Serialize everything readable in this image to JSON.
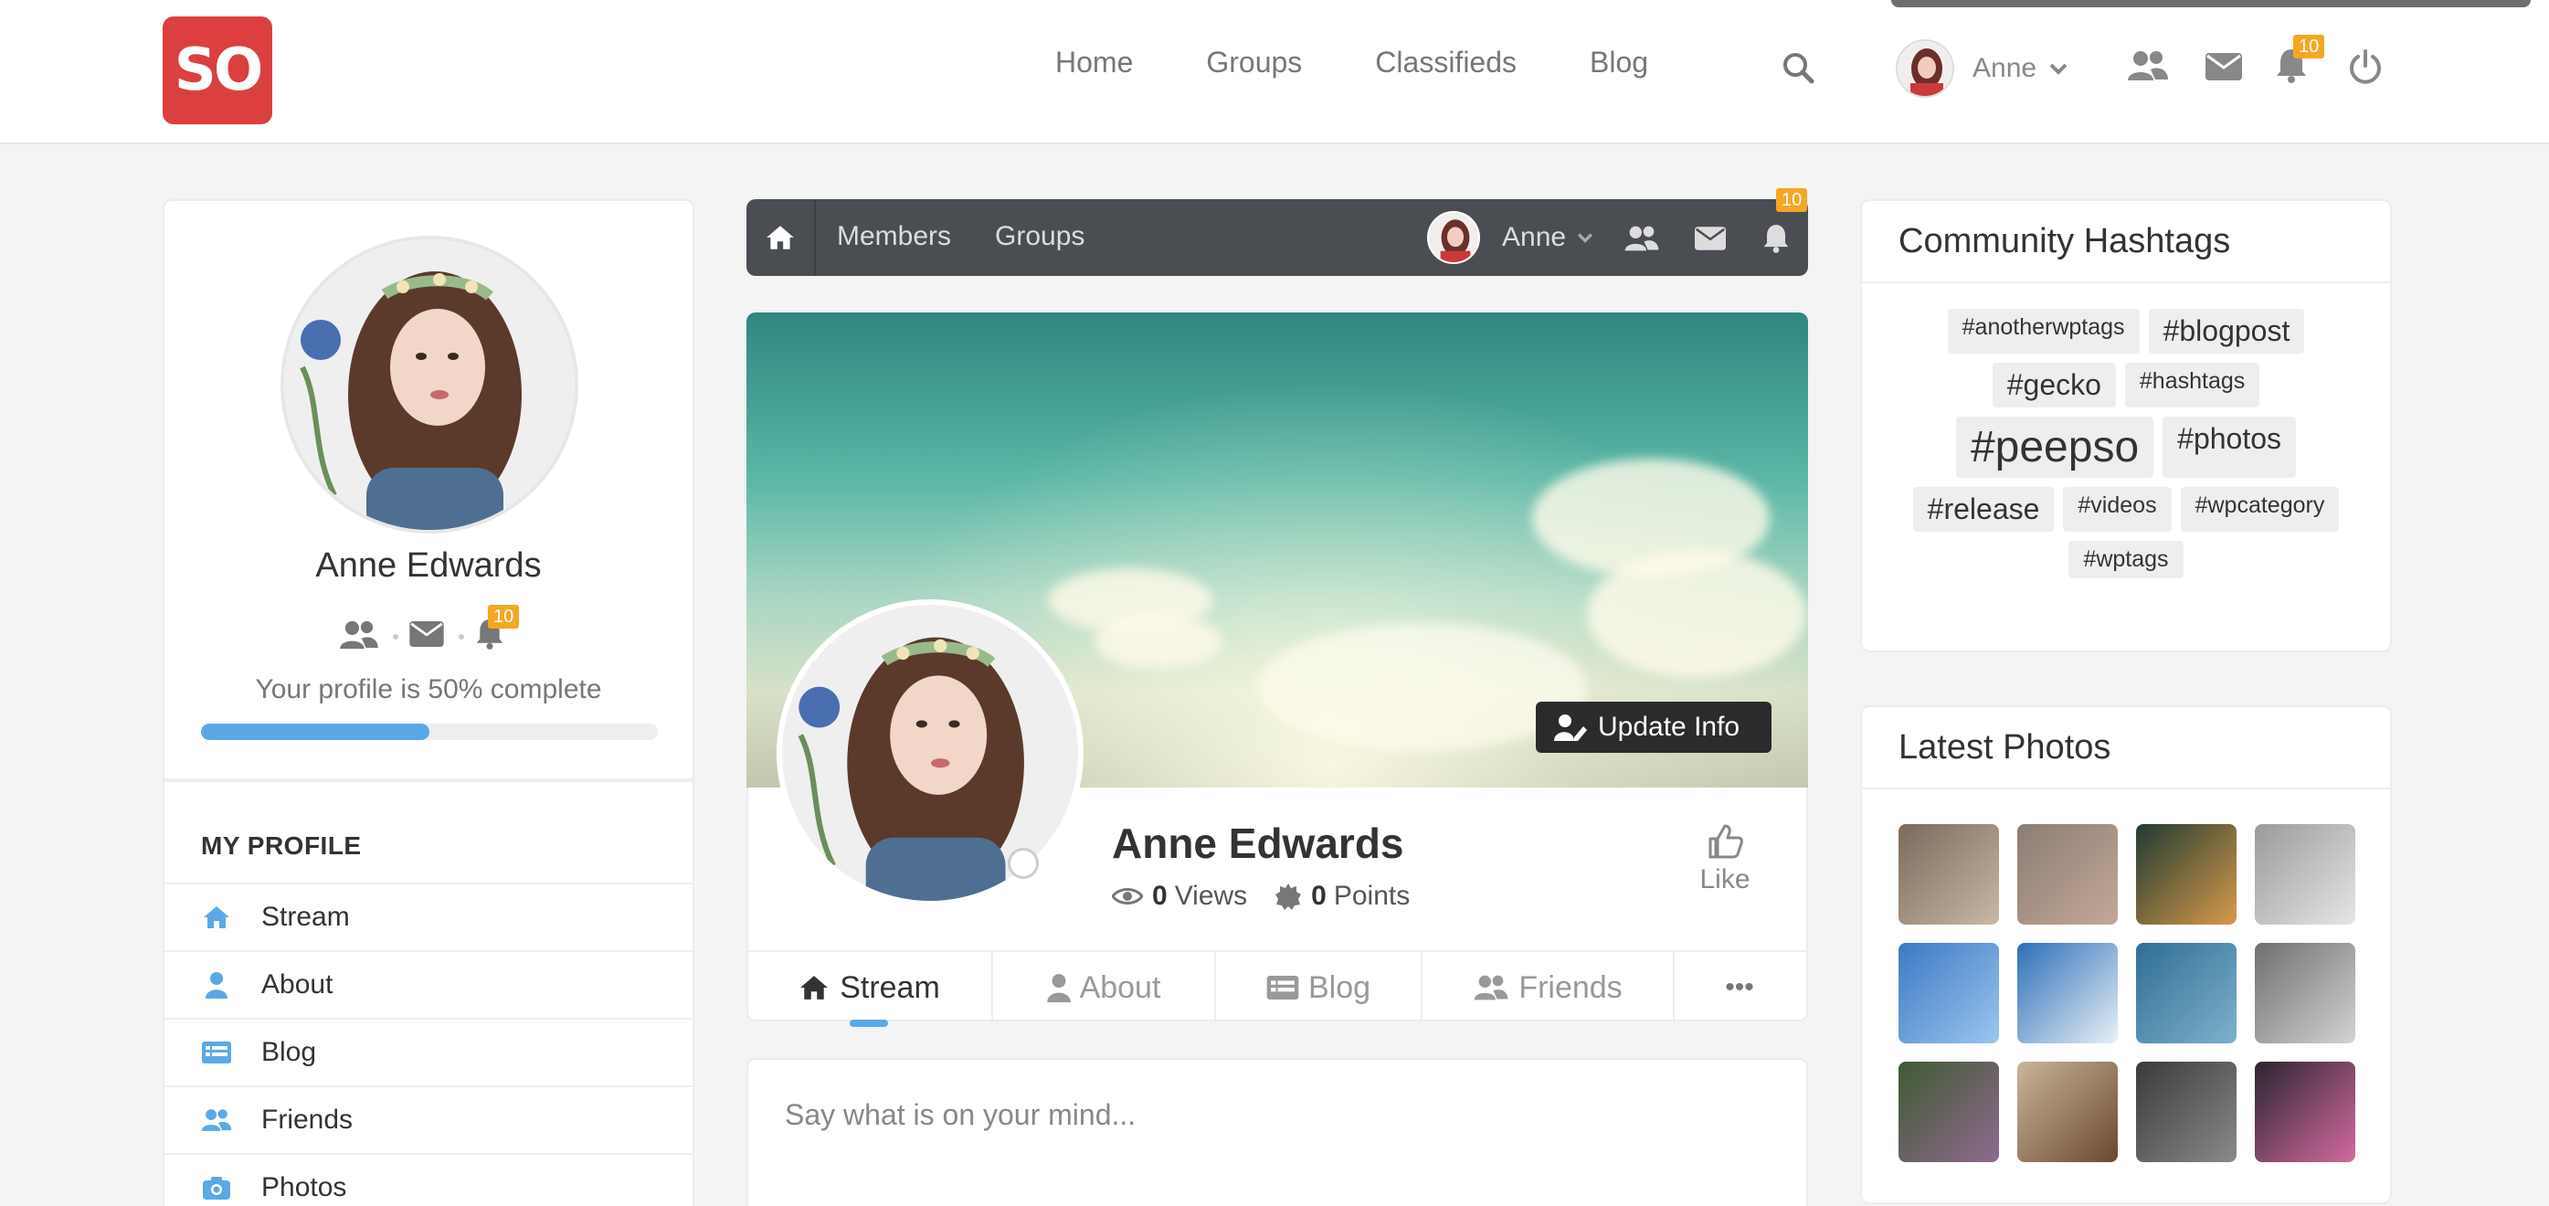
{
  "header": {
    "logo_text": "SO",
    "nav": [
      "Home",
      "Groups",
      "Classifieds",
      "Blog"
    ],
    "user_name": "Anne",
    "notifications_badge": "10"
  },
  "subnav": {
    "links": [
      "Members",
      "Groups"
    ],
    "user_name": "Anne",
    "notifications_badge": "10"
  },
  "sidebar": {
    "name": "Anne Edwards",
    "notifications_badge": "10",
    "profile_complete_text": "Your profile is 50% complete",
    "profile_complete_fraction": 0.5,
    "section_heading": "MY PROFILE",
    "items": [
      {
        "label": "Stream",
        "icon": "home-icon"
      },
      {
        "label": "About",
        "icon": "user-icon"
      },
      {
        "label": "Blog",
        "icon": "list-icon"
      },
      {
        "label": "Friends",
        "icon": "users-icon"
      },
      {
        "label": "Photos",
        "icon": "camera-icon"
      }
    ]
  },
  "profile": {
    "name": "Anne Edwards",
    "views_count": "0",
    "views_label": "Views",
    "points_count": "0",
    "points_label": "Points",
    "like_label": "Like",
    "update_info_label": "Update Info",
    "tabs": [
      {
        "label": "Stream",
        "icon": "home-icon",
        "active": true
      },
      {
        "label": "About",
        "icon": "user-icon"
      },
      {
        "label": "Blog",
        "icon": "list-icon"
      },
      {
        "label": "Friends",
        "icon": "users-icon"
      }
    ],
    "more_label": "•••"
  },
  "postbox": {
    "placeholder": "Say what is on your mind..."
  },
  "hashtags": {
    "title": "Community Hashtags",
    "tags": [
      {
        "text": "#anotherwptags",
        "size": "sm"
      },
      {
        "text": "#blogpost",
        "size": "md"
      },
      {
        "text": "#gecko",
        "size": "md"
      },
      {
        "text": "#hashtags",
        "size": "sm"
      },
      {
        "text": "#peepso",
        "size": "lg"
      },
      {
        "text": "#photos",
        "size": "md"
      },
      {
        "text": "#release",
        "size": "md"
      },
      {
        "text": "#videos",
        "size": "sm"
      },
      {
        "text": "#wpcategory",
        "size": "sm"
      },
      {
        "text": "#wptags",
        "size": "sm"
      }
    ]
  },
  "latest_photos": {
    "title": "Latest Photos",
    "colors": [
      [
        "#7a6a5c",
        "#c9b8a6"
      ],
      [
        "#8b7d74",
        "#c4a898"
      ],
      [
        "#1f3a33",
        "#d89a4a"
      ],
      [
        "#9a9a9a",
        "#e6e6e6"
      ],
      [
        "#3c79c4",
        "#9cc6ee"
      ],
      [
        "#2d6fb8",
        "#e8f0f6"
      ],
      [
        "#2f6e95",
        "#7fb1cc"
      ],
      [
        "#6f6f6f",
        "#d3d3d3"
      ],
      [
        "#3f5a34",
        "#8f6a8f"
      ],
      [
        "#c9b49a",
        "#6b4a2e"
      ],
      [
        "#3a3a3a",
        "#8a8a8a"
      ],
      [
        "#2b2530",
        "#d46aa0"
      ]
    ]
  },
  "colors": {
    "brand_red": "#dc3f3f",
    "accent_blue": "#5aa9e6",
    "badge_orange": "#f5a623",
    "subnav_bg": "#4a4d52"
  }
}
